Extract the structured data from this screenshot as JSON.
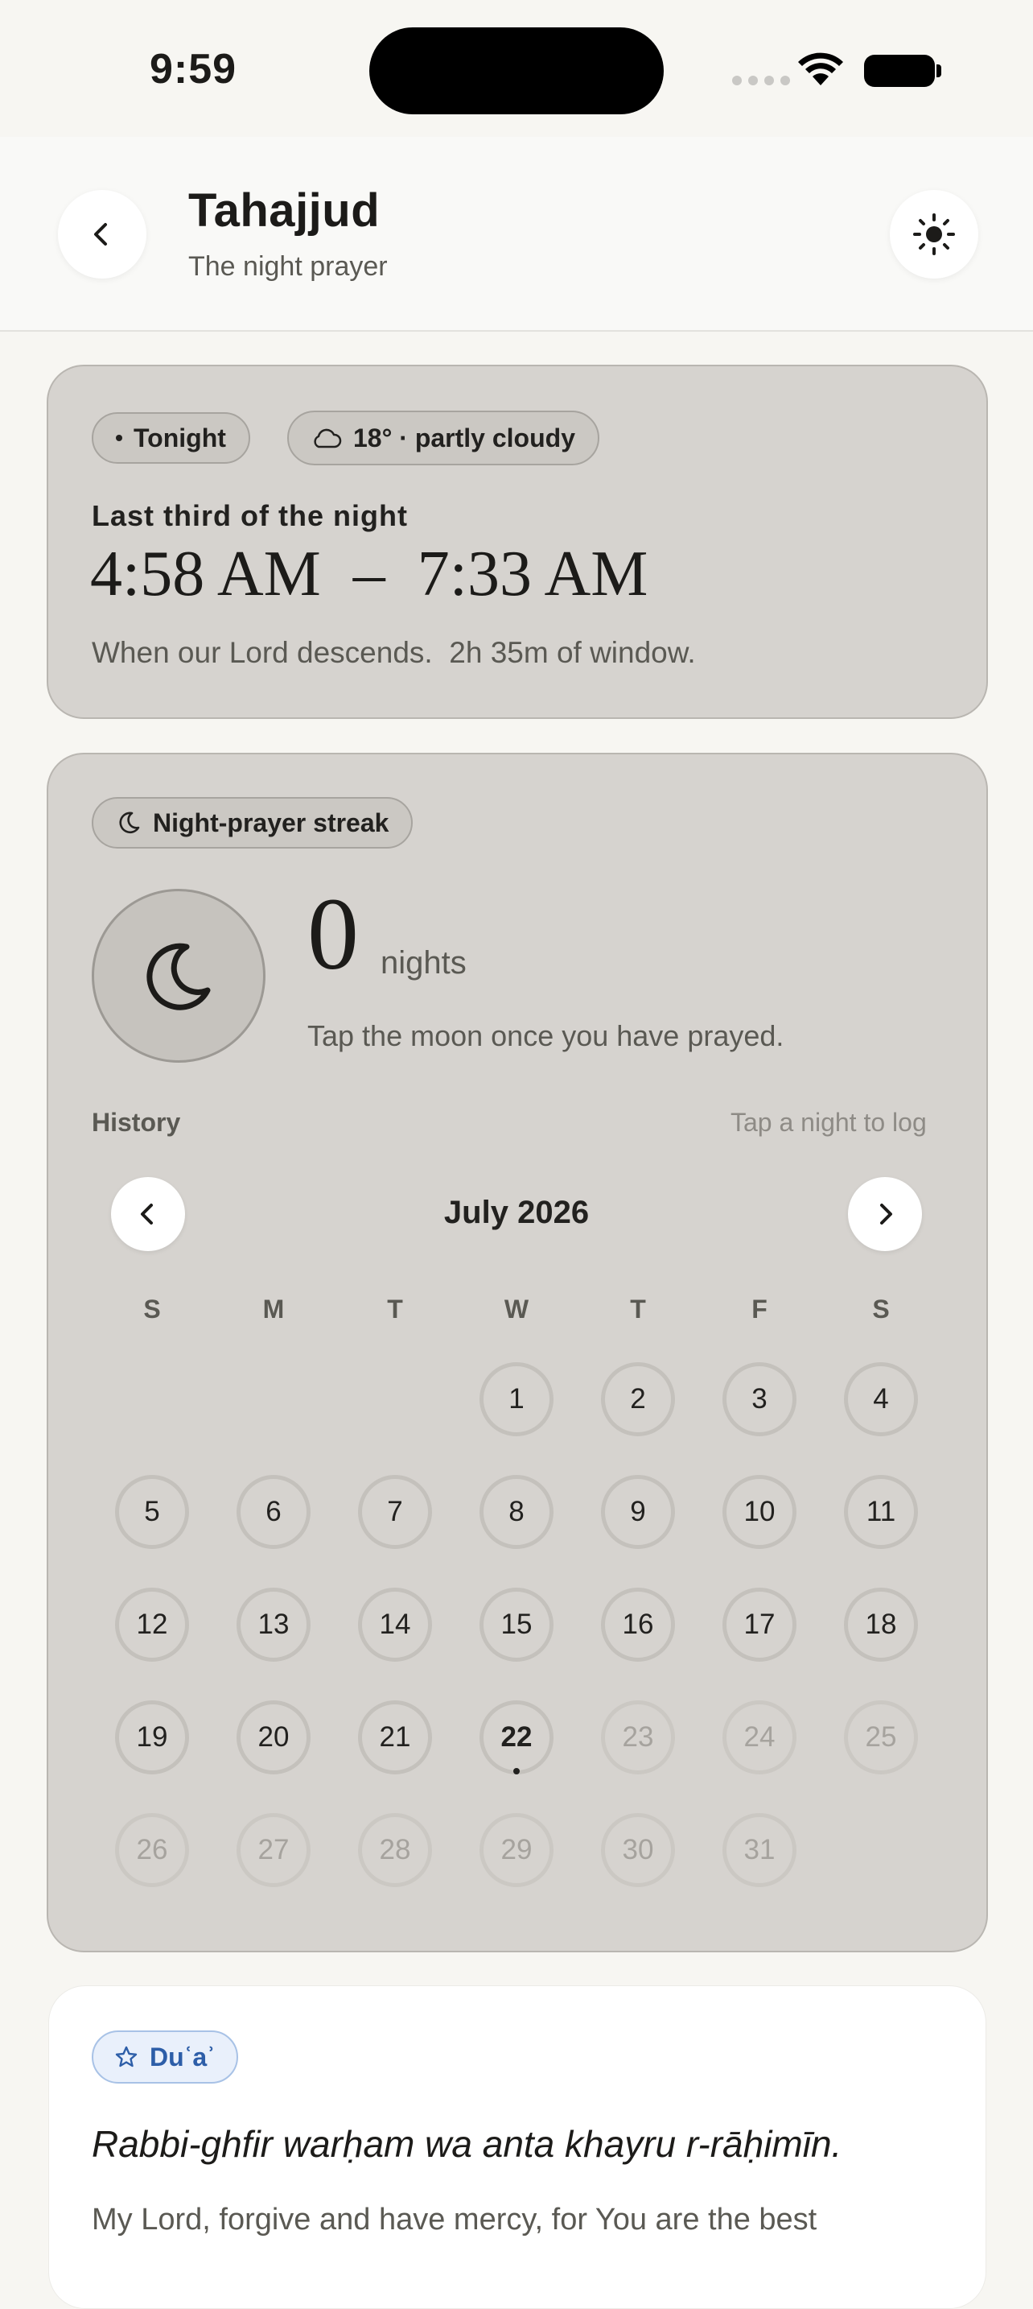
{
  "status_bar": {
    "time": "9:59"
  },
  "header": {
    "title": "Tahajjud",
    "subtitle": "The night prayer",
    "back_icon": "chevron-left-icon",
    "theme_icon": "sun-icon"
  },
  "window_card": {
    "tonight_label": "Tonight",
    "weather_label": "18° · partly cloudy",
    "heading": "Last third of the night",
    "time_range": "4:58 AM  –  7:33 AM",
    "description": "When our Lord descends.  2h 35m of window."
  },
  "streak_card": {
    "badge_label": "Night-prayer streak",
    "count": "0",
    "unit": "nights",
    "hint": "Tap the moon once you have prayed.",
    "history_label": "History",
    "history_hint": "Tap a night to log",
    "month_title": "July 2026",
    "weekdays": [
      "S",
      "M",
      "T",
      "W",
      "T",
      "F",
      "S"
    ],
    "days": [
      "1",
      "2",
      "3",
      "4",
      "5",
      "6",
      "7",
      "8",
      "9",
      "10",
      "11",
      "12",
      "13",
      "14",
      "15",
      "16",
      "17",
      "18",
      "19",
      "20",
      "21",
      "22",
      "23",
      "24",
      "25",
      "26",
      "27",
      "28",
      "29",
      "30",
      "31"
    ],
    "today": "22"
  },
  "dua_card": {
    "badge_label": "Duʿaʾ",
    "arabic_translit": "Rabbi-ghfir warḥam wa anta khayru r-rāḥimīn.",
    "translation": "My Lord, forgive and have mercy, for You are the best"
  }
}
